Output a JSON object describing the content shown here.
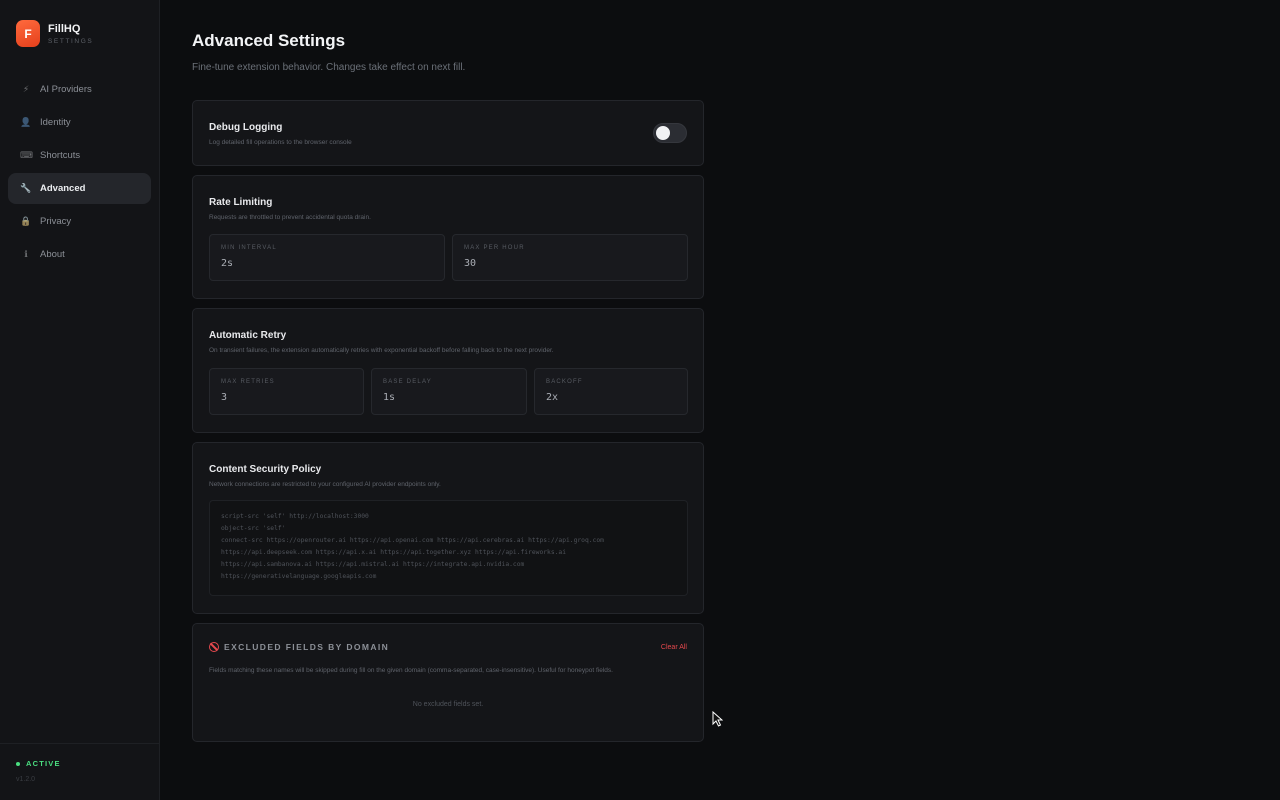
{
  "brand": {
    "logo_letter": "F",
    "name": "FillHQ",
    "subtitle": "SETTINGS"
  },
  "sidebar": {
    "items": [
      {
        "label": "AI Providers",
        "icon": "⚡",
        "icon_name": "bolt-icon",
        "active": false
      },
      {
        "label": "Identity",
        "icon": "👤",
        "icon_name": "user-icon",
        "active": false
      },
      {
        "label": "Shortcuts",
        "icon": "⌨",
        "icon_name": "keyboard-icon",
        "active": false
      },
      {
        "label": "Advanced",
        "icon": "🔧",
        "icon_name": "wrench-icon",
        "active": true
      },
      {
        "label": "Privacy",
        "icon": "🔒",
        "icon_name": "lock-icon",
        "active": false
      },
      {
        "label": "About",
        "icon": "ℹ",
        "icon_name": "info-icon",
        "active": false
      }
    ],
    "status": "ACTIVE",
    "version": "v1.2.0"
  },
  "page": {
    "title": "Advanced Settings",
    "subtitle": "Fine-tune extension behavior. Changes take effect on next fill."
  },
  "debug": {
    "title": "Debug Logging",
    "desc": "Log detailed fill operations to the browser console",
    "enabled": false
  },
  "rate": {
    "title": "Rate Limiting",
    "desc": "Requests are throttled to prevent accidental quota drain.",
    "fields": [
      {
        "label": "MIN INTERVAL",
        "value": "2s"
      },
      {
        "label": "MAX PER HOUR",
        "value": "30"
      }
    ]
  },
  "retry": {
    "title": "Automatic Retry",
    "desc": "On transient failures, the extension automatically retries with exponential backoff before falling back to the next provider.",
    "fields": [
      {
        "label": "MAX RETRIES",
        "value": "3"
      },
      {
        "label": "BASE DELAY",
        "value": "1s"
      },
      {
        "label": "BACKOFF",
        "value": "2x"
      }
    ]
  },
  "csp": {
    "title": "Content Security Policy",
    "desc": "Network connections are restricted to your configured AI provider endpoints only.",
    "lines": [
      "script-src 'self' http://localhost:3000",
      "object-src 'self'",
      "connect-src https://openrouter.ai https://api.openai.com https://api.cerebras.ai https://api.groq.com",
      "https://api.deepseek.com https://api.x.ai https://api.together.xyz https://api.fireworks.ai",
      "https://api.sambanova.ai https://api.mistral.ai https://integrate.api.nvidia.com",
      "https://generativelanguage.googleapis.com"
    ]
  },
  "excluded": {
    "title": "EXCLUDED FIELDS BY DOMAIN",
    "clear_label": "Clear All",
    "desc": "Fields matching these names will be skipped during fill on the given domain (comma-separated, case-insensitive). Useful for honeypot fields.",
    "empty": "No excluded fields set."
  },
  "colors": {
    "accent": "#ff5a2e",
    "danger": "#e5484d",
    "success": "#4ade80",
    "background": "#0c0d0f",
    "sidebar": "#131417"
  }
}
